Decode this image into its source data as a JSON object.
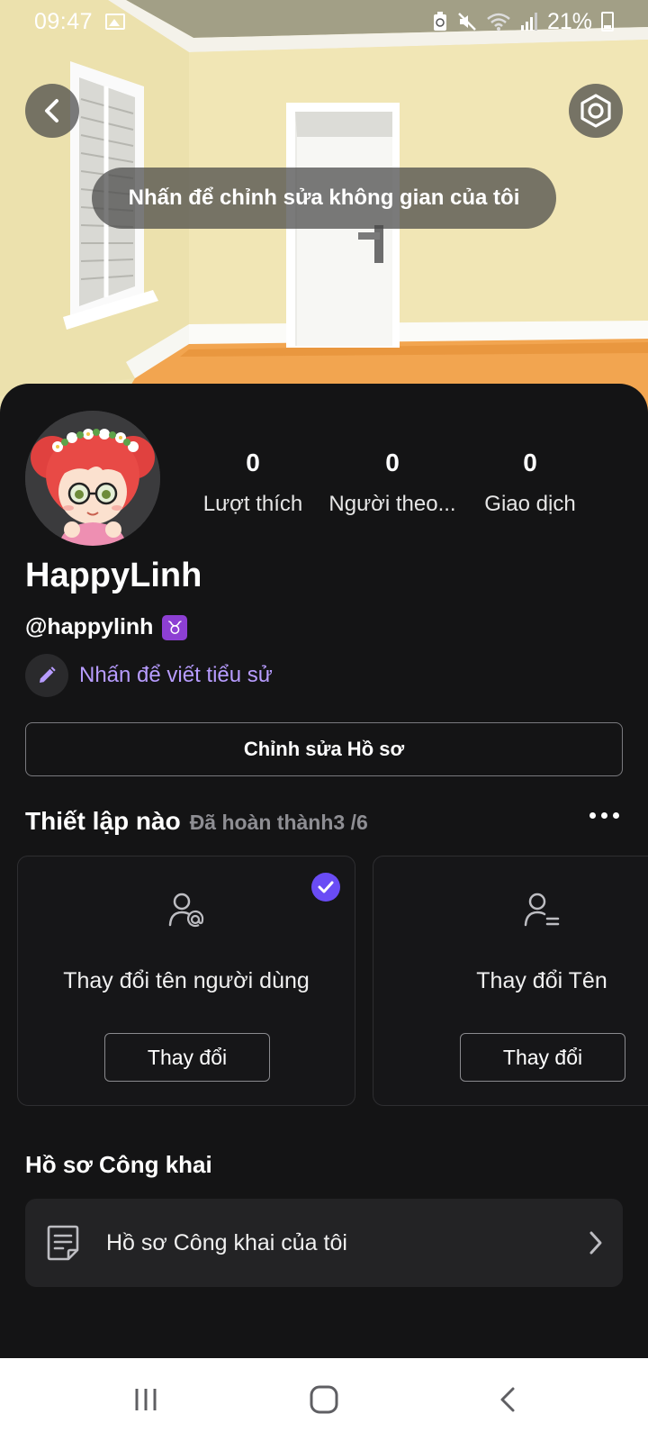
{
  "status_bar": {
    "time": "09:47",
    "battery": "21%"
  },
  "scene": {
    "edit_space_label": "Nhấn để chỉnh sửa không gian của tôi"
  },
  "profile": {
    "stats": [
      {
        "value": "0",
        "label": "Lượt thích"
      },
      {
        "value": "0",
        "label": "Người theo..."
      },
      {
        "value": "0",
        "label": "Giao dịch"
      }
    ],
    "display_name": "HappyLinh",
    "handle": "@happylinh",
    "zodiac": "♉",
    "bio_prompt": "Nhấn để viết tiểu sử",
    "edit_profile_label": "Chỉnh sửa Hồ sơ"
  },
  "setup": {
    "title": "Thiết lập nào",
    "progress": "Đã hoàn thành3 /6",
    "cards": [
      {
        "title": "Thay đổi tên người dùng",
        "button": "Thay đổi",
        "completed": true,
        "icon": "user-at-icon"
      },
      {
        "title": "Thay đổi Tên",
        "button": "Thay đổi",
        "completed": false,
        "icon": "user-lines-icon"
      }
    ]
  },
  "public_profile": {
    "section_title": "Hồ sơ Công khai",
    "row_label": "Hồ sơ Công khai của tôi"
  },
  "colors": {
    "accent": "#6a4cf5",
    "bio_link": "#b79cff",
    "background": "#141415"
  }
}
